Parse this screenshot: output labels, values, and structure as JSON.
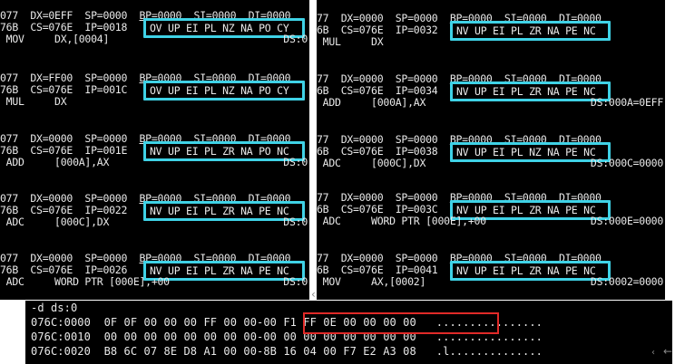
{
  "left_panel": [
    {
      "reg1": "077  DX=0EFF  SP=0000  ",
      "reg1u": "BP=0000  SI=0000  DI=0000",
      "reg2": "76B  CS=076E  IP=0018 ",
      "flags": "OV UP EI PL NZ NA PO CY",
      "instr": " MOV     DX,[0004]",
      "tail": "DS:0"
    },
    {
      "reg1": "077  DX=FF00  SP=0000  ",
      "reg1u": "BP=0000  SI=0000  DI=0000",
      "reg2": "76B  CS=076E  IP=001C ",
      "flags": "OV UP EI PL NZ NA PO CY",
      "instr": " MUL     DX",
      "tail": ""
    },
    {
      "reg1": "077  DX=0000  SP=0000  ",
      "reg1u": "BP=0000  SI=0000  DI=0000",
      "reg2": "76B  CS=076E  IP=001E ",
      "flags": "NV UP EI PL ZR NA PO NC",
      "instr": " ADD     [000A],AX",
      "tail": "DS:0"
    },
    {
      "reg1": "077  DX=0000  SP=0000  ",
      "reg1u": "BP=0000  SI=0000  DI=0000",
      "reg2": "76B  CS=076E  IP=0022 ",
      "flags": "NV UP EI PL ZR NA PE NC",
      "instr": " ADC     [000C],DX",
      "tail": "DS:0"
    },
    {
      "reg1": "077  DX=0000  SP=0000  ",
      "reg1u": "BP=0000  SI=0000  DI=0000",
      "reg2": "76B  CS=076E  IP=0026 ",
      "flags": "NV UP EI PL ZR NA PE NC",
      "instr": " ADC     WORD PTR [000E],+00",
      "tail": "DS:0"
    }
  ],
  "right_panel": [
    {
      "reg1": "77  DX=0000  SP=0000  ",
      "reg1u": "BP=0000  SI=0000  DI=0000",
      "reg2": "6B  CS=076E  IP=0032 ",
      "flags": "NV UP EI PL ZR NA PE NC",
      "instr": " MUL     DX",
      "tail": ""
    },
    {
      "reg1": "77  DX=0000  SP=0000  ",
      "reg1u": "BP=0000  SI=0000  DI=0000",
      "reg2": "6B  CS=076E  IP=0034 ",
      "flags": "NV UP EI PL ZR NA PE NC",
      "instr": " ADD     [000A],AX",
      "tail": "DS:000A=0EFF"
    },
    {
      "reg1": "77  DX=0000  SP=0000  ",
      "reg1u": "BP=0000  SI=0000  DI=0000",
      "reg2": "6B  CS=076E  IP=0038 ",
      "flags": "NV UP EI PL NZ NA PE NC",
      "instr": " ADC     [000C],DX",
      "tail": "DS:000C=0000"
    },
    {
      "reg1": "77  DX=0000  SP=0000  ",
      "reg1u": "BP=0000  SI=0000  DI=0000",
      "reg2": "6B  CS=076E  IP=003C ",
      "flags": "NV UP EI PL ZR NA PE NC",
      "instr": " ADC     WORD PTR [000E],+00",
      "tail": "DS:000E=0000"
    },
    {
      "reg1": "77  DX=0000  SP=0000  ",
      "reg1u": "BP=0000  SI=0000  DI=0000",
      "reg2": "6B  CS=076E  IP=0041 ",
      "flags": "NV UP EI PL ZR NA PE NC",
      "instr": " MOV     AX,[0002]",
      "tail": "DS:0002=0000"
    }
  ],
  "dump": {
    "command": "-d ds:0",
    "lines": [
      "076C:0000  0F 0F 00 00 00 FF 00 00-00 F1 FF 0E 00 00 00 00   ................",
      "076C:0010  00 00 00 00 00 00 00 00-00 00 00 00 00 00 00 00   ................",
      "076C:0020  B8 6C 07 8E D8 A1 00 00-8B 16 04 00 F7 E2 A3 08   .l.............."
    ]
  },
  "colors": {
    "highlight_flags": "#3fd2e6",
    "highlight_result": "#e02a28"
  },
  "icons": {
    "edge_arrow": "left-arrow-icon"
  }
}
